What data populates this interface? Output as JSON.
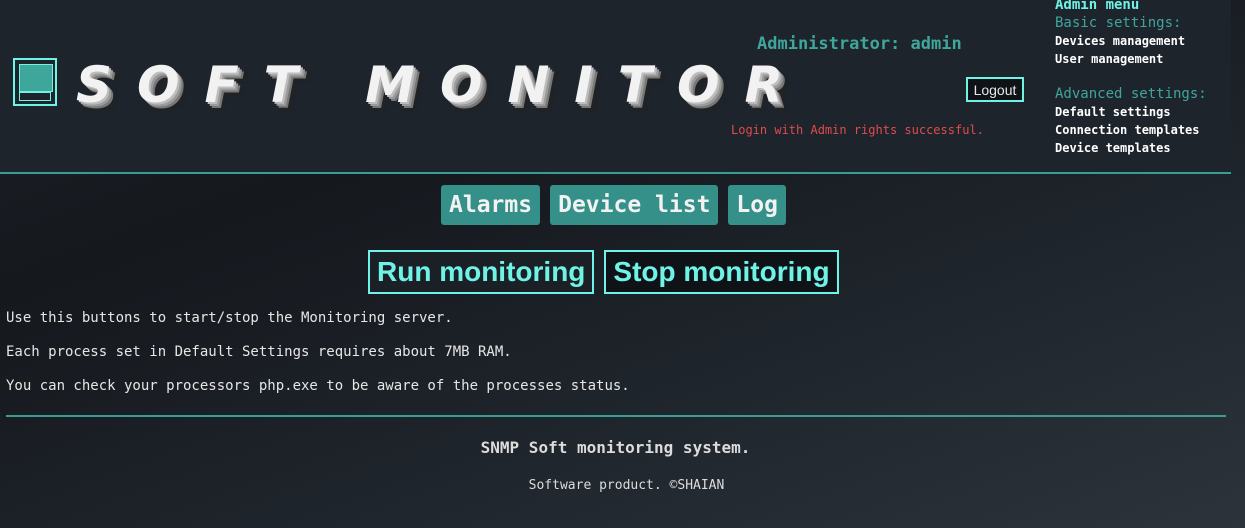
{
  "header": {
    "logo_text": "SOFT MONITOR",
    "admin_label": "Administrator: admin",
    "logout_label": "Logout",
    "login_message": "Login with Admin rights successful."
  },
  "admin_menu": {
    "title": "Admin menu",
    "basic_heading": "Basic settings:",
    "basic_items": [
      "Devices management",
      "User management"
    ],
    "advanced_heading": "Advanced settings:",
    "advanced_items": [
      "Default settings",
      "Connection templates",
      "Device templates"
    ]
  },
  "nav": {
    "items": [
      "Alarms",
      "Device list",
      "Log"
    ]
  },
  "monitoring": {
    "run_label": "Run monitoring",
    "stop_label": "Stop monitoring"
  },
  "info": {
    "lines": [
      "Use this buttons to start/stop the Monitoring server.",
      "Each process set in Default Settings requires about 7MB RAM.",
      "You can check your processors php.exe to be aware of the processes status."
    ]
  },
  "footer": {
    "title": "SNMP Soft monitoring system.",
    "subtitle": "Software product. ©SHAIAN"
  },
  "colors": {
    "accent": "#3fa69c",
    "highlight": "#6ff3e6",
    "error": "#e04b4b",
    "nav_button": "#349088"
  }
}
